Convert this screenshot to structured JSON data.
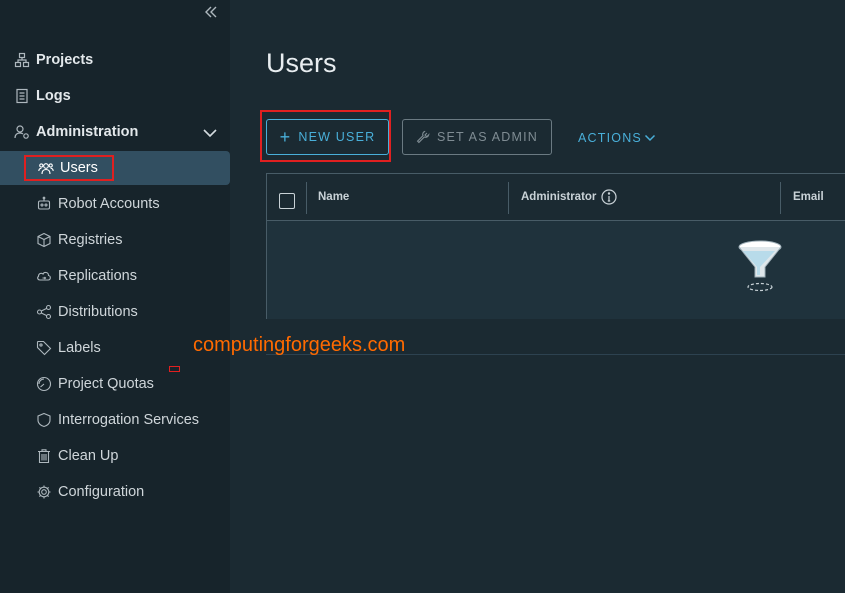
{
  "sidebar": {
    "collapse_icon": "double-chevron-left-icon",
    "top_items": [
      {
        "label": "Projects",
        "icon": "projects-icon"
      },
      {
        "label": "Logs",
        "icon": "logs-icon"
      },
      {
        "label": "Administration",
        "icon": "administration-icon",
        "expanded": true
      }
    ],
    "admin_items": [
      {
        "label": "Users",
        "icon": "users-icon",
        "active": true
      },
      {
        "label": "Robot Accounts",
        "icon": "robot-icon"
      },
      {
        "label": "Registries",
        "icon": "registries-icon"
      },
      {
        "label": "Replications",
        "icon": "replications-icon"
      },
      {
        "label": "Distributions",
        "icon": "distributions-icon"
      },
      {
        "label": "Labels",
        "icon": "labels-icon"
      },
      {
        "label": "Project Quotas",
        "icon": "quotas-icon"
      },
      {
        "label": "Interrogation Services",
        "icon": "shield-icon"
      },
      {
        "label": "Clean Up",
        "icon": "trash-icon"
      },
      {
        "label": "Configuration",
        "icon": "gear-icon"
      }
    ]
  },
  "main": {
    "title": "Users",
    "toolbar": {
      "new_user_label": "NEW USER",
      "set_admin_label": "SET AS ADMIN",
      "actions_label": "ACTIONS"
    },
    "grid": {
      "columns": [
        "Name",
        "Administrator",
        "Email"
      ],
      "rows": [],
      "empty_icon": "filter-funnel-icon"
    }
  },
  "watermark": "computingforgeeks.com",
  "colors": {
    "accent": "#49afd9",
    "sidebar_bg": "#17242b",
    "main_bg": "#1b2a32",
    "active_item_bg": "#324f61",
    "highlight_red": "#e02020",
    "watermark": "#ff6a00"
  }
}
